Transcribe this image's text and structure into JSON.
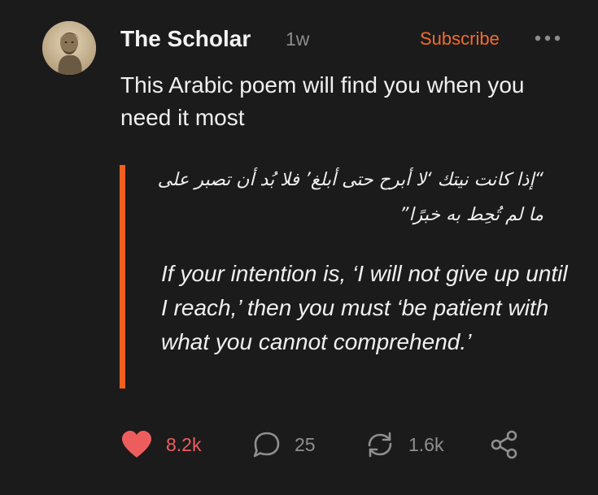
{
  "post": {
    "author": "The Scholar",
    "time": "1w",
    "subscribe_label": "Subscribe",
    "text": "This Arabic poem will find you when you need it most"
  },
  "quote": {
    "arabic": "“إذا كانت نيتك ‘لا أبرح حتى أبلغ’ فلا بُد أن تصبر على ما لم تُحِط به خبرًا”",
    "english": "If your intention is, ‘I will not give up until I reach,’ then you must ‘be patient with what you cannot comprehend.’"
  },
  "actions": {
    "likes": "8.2k",
    "comments": "25",
    "restacks": "1.6k"
  },
  "colors": {
    "background": "#1b1b1c",
    "accent": "#f36b2a",
    "like": "#ee5d5d",
    "muted": "#8f8f8f"
  },
  "icons": [
    "avatar-portrait",
    "more-icon",
    "heart-icon",
    "comment-icon",
    "restack-icon",
    "share-icon"
  ]
}
